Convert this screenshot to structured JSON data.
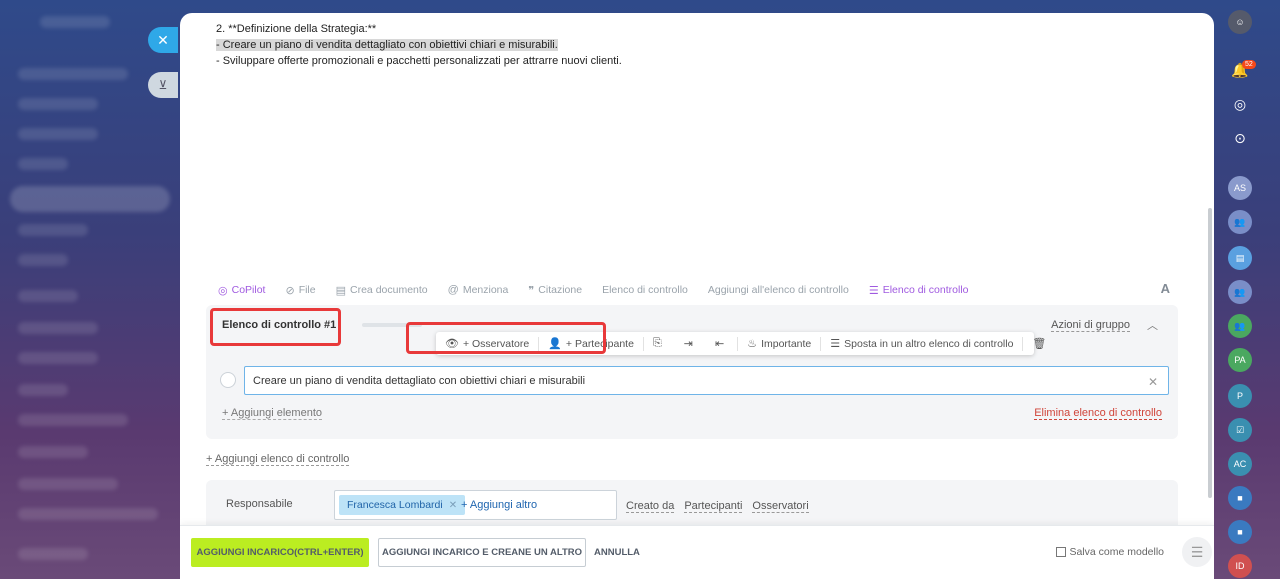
{
  "editor": {
    "line1": "2. **Definizione della Strategia:**",
    "line2": "- Creare un piano di vendita dettagliato con obiettivi chiari e misurabili.",
    "line3": "- Sviluppare offerte promozionali e pacchetti personalizzati per attrarre nuovi clienti."
  },
  "toolbar": {
    "copilot": "CoPilot",
    "file": "File",
    "create_doc": "Crea documento",
    "mention": "Menziona",
    "quote": "Citazione",
    "checklist": "Elenco di controllo",
    "add_to_checklist": "Aggiungi all'elenco di controllo",
    "checklist_active": "Elenco di controllo",
    "format": "A"
  },
  "checklist": {
    "title": "Elenco di controllo #1",
    "group_actions": "Azioni di gruppo",
    "item_text": "Creare un piano di vendita dettagliato con obiettivi chiari e misurabili",
    "add_item": "+ Aggiungi elemento",
    "delete": "Elimina elenco di controllo",
    "popup": {
      "observer": "+ Osservatore",
      "participant": "+ Partecipante",
      "important": "Importante",
      "move": "Sposta in un altro elenco di controllo"
    }
  },
  "add_checklist": "+ Aggiungi elenco di controllo",
  "responsible": {
    "label": "Responsabile",
    "user": "Francesca Lombardi",
    "add_more": "+ Aggiungi altro",
    "created_by": "Creato da",
    "participants": "Partecipanti",
    "observers": "Osservatori"
  },
  "footer": {
    "add_task": "AGGIUNGI INCARICO(CTRL+ENTER)",
    "add_and_create": "AGGIUNGI INCARICO E CREANE UN ALTRO",
    "cancel": "ANNULLA",
    "save_template": "Salva come modello"
  },
  "rightbar": {
    "notification_count": "52",
    "avatars": [
      "AS",
      "PA",
      "P",
      "AC",
      "ID"
    ]
  },
  "colors": {
    "primary_button": "#bbed21",
    "highlight_box": "#e8393a",
    "accent_purple": "#a05ae0",
    "delete_red": "#d0453a"
  }
}
